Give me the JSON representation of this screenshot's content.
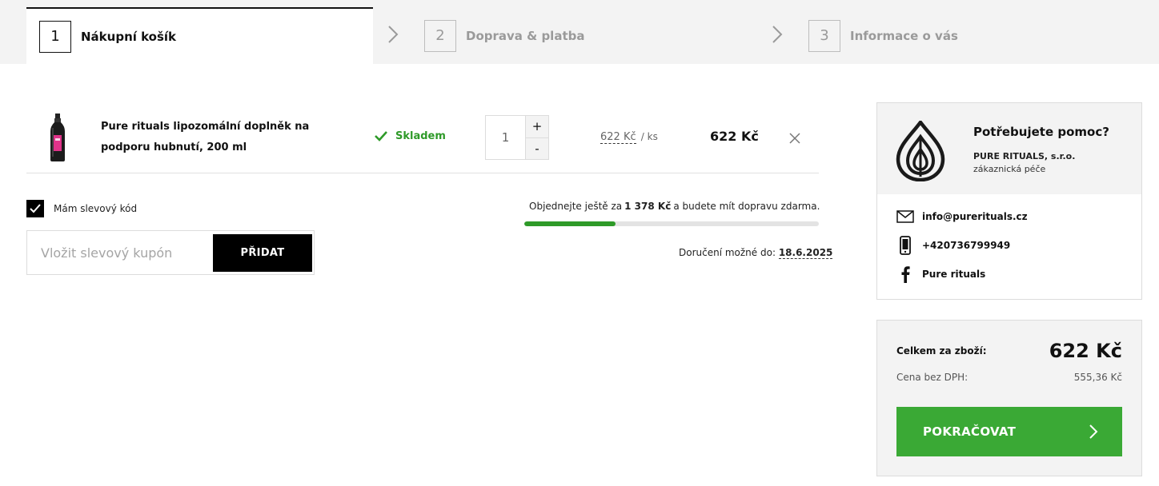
{
  "steps": [
    {
      "number": "1",
      "label": "Nákupní košík"
    },
    {
      "number": "2",
      "label": "Doprava & platba"
    },
    {
      "number": "3",
      "label": "Informace o vás"
    }
  ],
  "cart_item": {
    "name": "Pure rituals lipozomální doplněk na podporu hubnutí, 200 ml",
    "stock": "Skladem",
    "quantity": "1",
    "qty_plus": "+",
    "qty_minus": "-",
    "unit_price": "622 Kč",
    "unit_suffix": "/ ks",
    "total_price": "622 Kč"
  },
  "coupon": {
    "checkbox_label": "Mám slevový kód",
    "checked": true,
    "input_placeholder": "Vložit slevový kupón",
    "button_label": "PŘIDAT"
  },
  "shipping": {
    "text_before": "Objednejte ještě za",
    "amount": "1 378 Kč",
    "text_after": "a budete mít dopravu zdarma.",
    "progress_fraction": 0.311,
    "delivery_label": "Doručení možné do:",
    "delivery_date": "18.6.2025"
  },
  "help": {
    "title": "Potřebujete pomoc?",
    "company": "PURE RITUALS, s.r.o.",
    "subtitle": "zákaznická péče",
    "email": "info@purerituals.cz",
    "phone": "+420736799949",
    "facebook": "Pure rituals"
  },
  "summary": {
    "total_label": "Celkem za zboží:",
    "total_value": "622 Kč",
    "net_label": "Cena bez DPH:",
    "net_value": "555,36 Kč",
    "continue_label": "POKRAČOVAT"
  },
  "colors": {
    "accent_green": "#3aa935",
    "stock_green": "#2e9a28",
    "bar_bg": "#f3f3f3"
  },
  "icons": [
    "chevron-right-icon",
    "check-icon",
    "close-icon",
    "truck-icon",
    "logo-icon",
    "mail-icon",
    "phone-icon",
    "facebook-icon"
  ]
}
